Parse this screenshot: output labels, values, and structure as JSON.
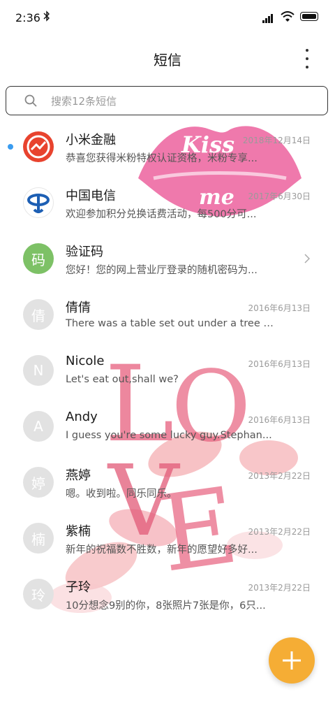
{
  "status_bar": {
    "time": "2:36"
  },
  "header": {
    "title": "短信"
  },
  "search": {
    "placeholder": "搜索12条短信"
  },
  "wallpaper": {
    "kiss_text_1": "Kiss",
    "kiss_text_2": "me",
    "love_letters": [
      "L",
      "O",
      "V",
      "E"
    ]
  },
  "conversations": [
    {
      "name": "小米金融",
      "date": "2018年12月14日",
      "preview": "恭喜您获得米粉特权认证资格，米粉专享...",
      "unread": true,
      "avatar": "mi-finance-logo"
    },
    {
      "name": "中国电信",
      "date": "2017年6月30日",
      "preview": "欢迎参加积分兑换话费活动，每500分可...",
      "avatar": "china-telecom-logo"
    },
    {
      "name": "验证码",
      "date": "",
      "preview": "您好！您的网上营业厅登录的随机密码为...",
      "avatar_text": "码",
      "avatar_color": "#7dc166"
    },
    {
      "name": "倩倩",
      "date": "2016年6月13日",
      "preview": "There was a table set out under a tree i...",
      "avatar_text": "倩"
    },
    {
      "name": "Nicole",
      "date": "2016年6月13日",
      "preview": "Let's eat out,shall we?",
      "avatar_text": "N"
    },
    {
      "name": "Andy",
      "date": "2016年6月13日",
      "preview": "I guess you're some lucky guy.Stephan...",
      "avatar_text": "A"
    },
    {
      "name": "燕婷",
      "date": "2013年2月22日",
      "preview": "嗯。收到啦。同乐同乐。",
      "avatar_text": "婷"
    },
    {
      "name": "紫楠",
      "date": "2013年2月22日",
      "preview": "新年的祝福数不胜数，新年的愿望好多好...",
      "avatar_text": "楠"
    },
    {
      "name": "子玲",
      "date": "2013年2月22日",
      "preview": "10分想念9别的你，8张照片7张是你，6只...",
      "avatar_text": "玲"
    }
  ],
  "colors": {
    "accent": "#f5ad35",
    "unread_dot": "#3a9cf0",
    "love_pink": "#e8607e",
    "kiss_pink": "#ec5c9a"
  }
}
